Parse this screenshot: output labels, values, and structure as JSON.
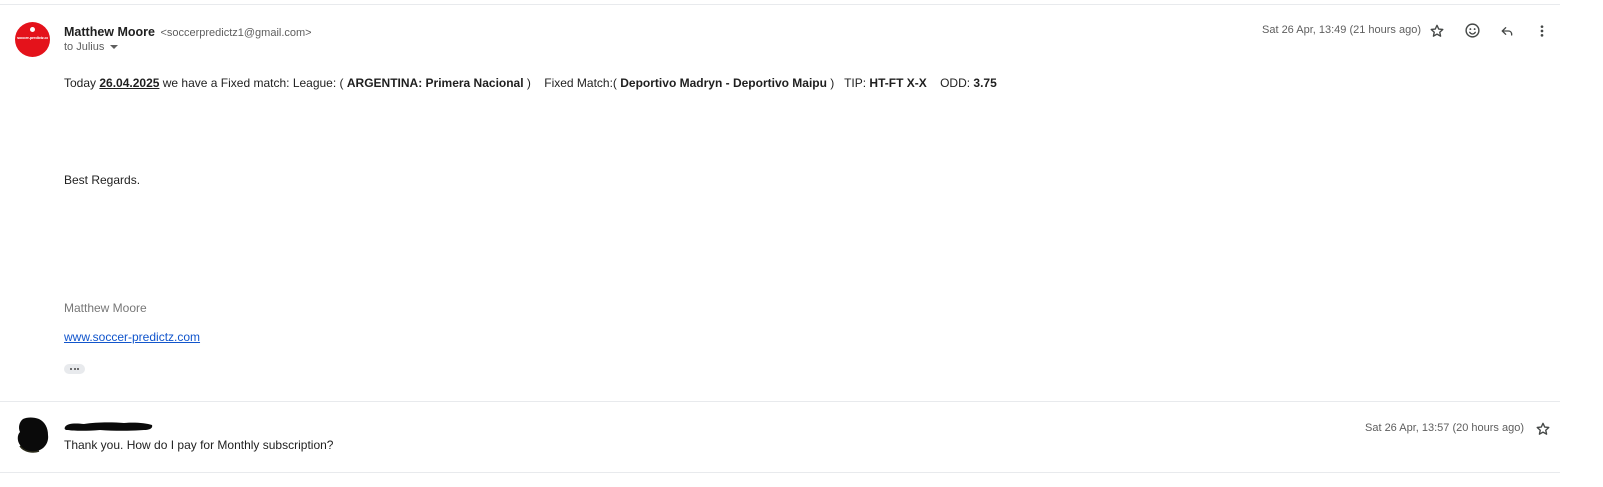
{
  "message1": {
    "avatar_logo_text": "soccer-predictz.com",
    "sender_name": "Matthew Moore",
    "sender_email": "<soccerpredictz1@gmail.com>",
    "to_label": "to Julius",
    "date": "Sat 26 Apr, 13:49 (21 hours ago)",
    "body": {
      "today": "Today ",
      "date": "26.04.2025",
      "fixed_match_text": " we have a Fixed match: League: ( ",
      "league": "ARGENTINA: Primera Nacional",
      "league_close": " )    Fixed Match:( ",
      "match": "Deportivo Madryn - Deportivo Maipu",
      "match_close": " )   TIP: ",
      "tip": "HT-FT X-X",
      "odd_label": "    ODD: ",
      "odd": "3.75"
    },
    "regards": "Best Regards.",
    "signature_name": "Matthew Moore",
    "signature_link": "www.soccer-predictz.com"
  },
  "message2": {
    "preview": "Thank you. How do I pay for Monthly subscription?",
    "date": "Sat 26 Apr, 13:57 (20 hours ago)"
  },
  "icons": {
    "star": "star-icon",
    "emoji": "emoji-icon",
    "reply": "reply-icon",
    "more": "more-vert-icon"
  },
  "colors": {
    "avatar_red": "#e4121b",
    "link_blue": "#1155cc",
    "muted_text": "#5e5e5e"
  }
}
